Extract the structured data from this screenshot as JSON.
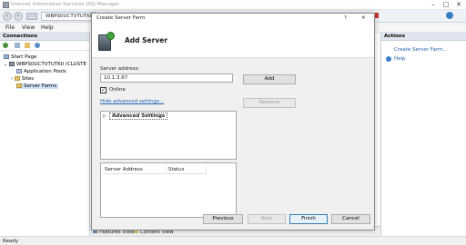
{
  "window": {
    "title": "Internet Information Services (IIS) Manager",
    "address_text": "WBPS0UCTVTUTKII",
    "menu": [
      "File",
      "View",
      "Help"
    ]
  },
  "left_pane": {
    "header": "Connections",
    "tree": [
      {
        "label": "Start Page"
      },
      {
        "label": "WBPS0UCTVTUTKII (CLUSTE"
      },
      {
        "label": "Application Pools"
      },
      {
        "label": "Sites"
      },
      {
        "label": "Server Farms"
      }
    ]
  },
  "right_pane": {
    "header": "Actions",
    "items": [
      "Create Server Farm...",
      "Help"
    ]
  },
  "bottom": {
    "features_view": "Features View",
    "content_view": "Content View",
    "status": "Ready"
  },
  "dialog": {
    "title": "Create Server Farm",
    "help_glyph": "?",
    "close_glyph": "✕",
    "heading": "Add Server",
    "server_address_label": "Server address:",
    "server_address_value": "10.1.3.67",
    "online_label": "Online",
    "online_checked": true,
    "add_button": "Add",
    "remove_button": "Remove",
    "hide_advanced_link": "Hide advanced settings...",
    "advanced_settings_label": "Advanced Settings",
    "table_headers": [
      "Server Address",
      "Status"
    ],
    "buttons": {
      "previous": "Previous",
      "next": "Next",
      "finish": "Finish",
      "cancel": "Cancel"
    }
  },
  "colors": {
    "link": "#1f5fb0",
    "pane_header": "#dfe6ef",
    "selected_row": "#cfe2f6",
    "dialog_bg": "#f0f0f0"
  }
}
